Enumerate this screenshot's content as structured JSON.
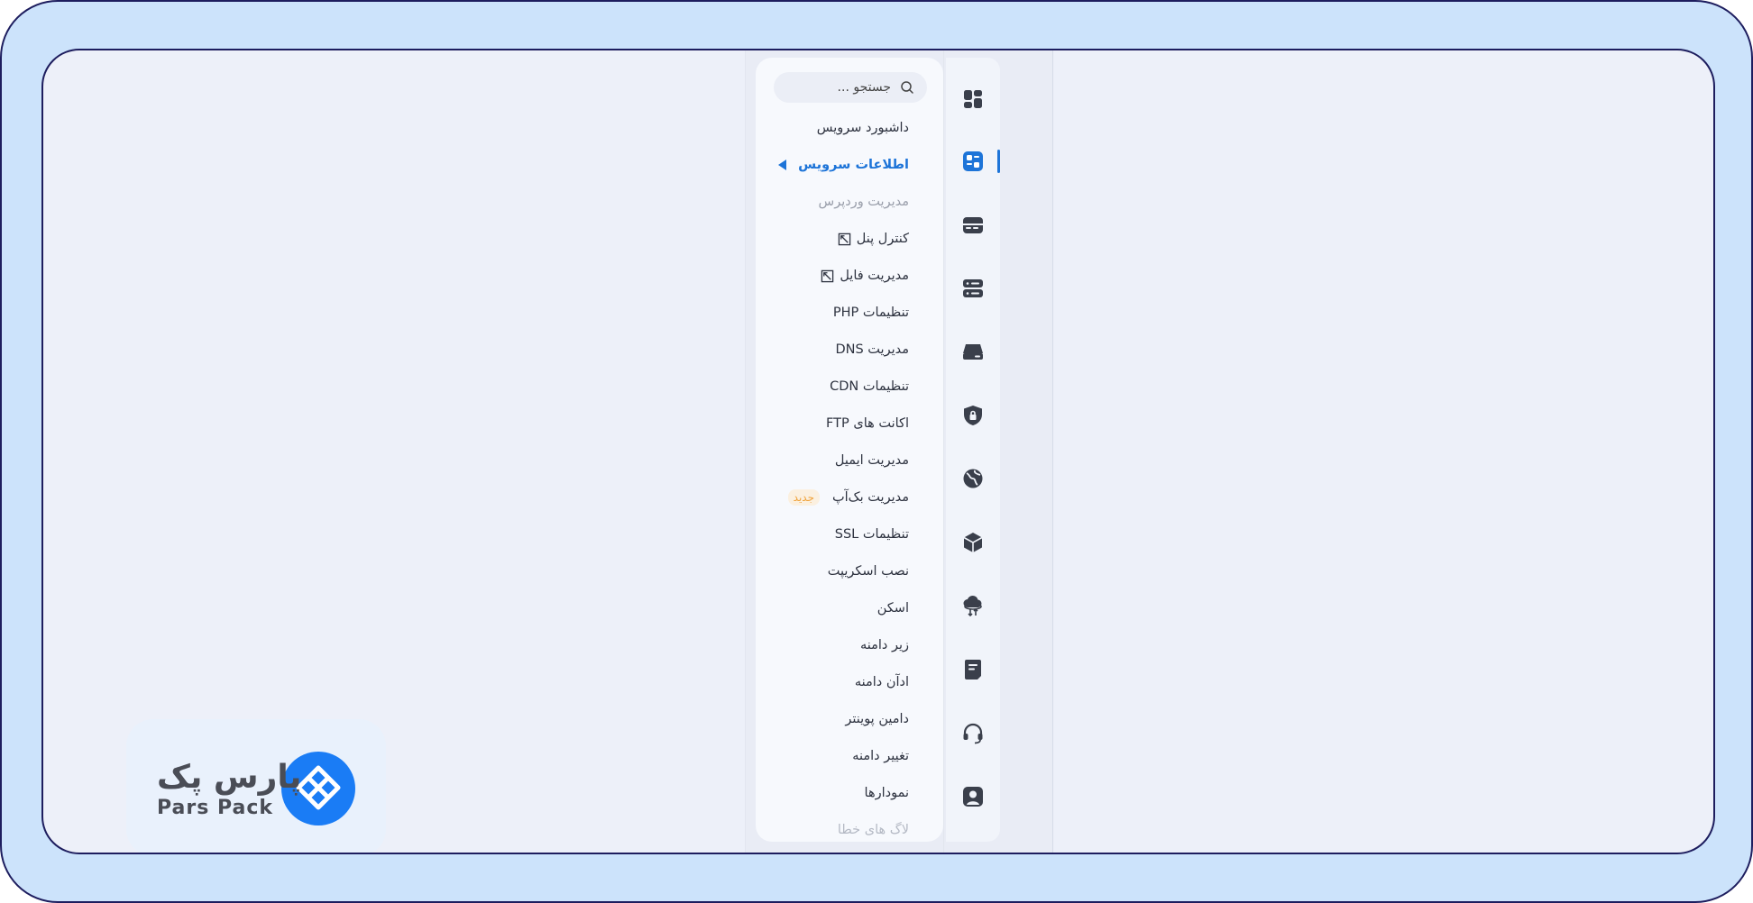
{
  "search": {
    "placeholder": "جستجو ..."
  },
  "menu": {
    "items": [
      {
        "label": "داشبورد سرویس"
      },
      {
        "label": "اطلاعات سرویس"
      },
      {
        "label": "مدیریت وردپرس"
      },
      {
        "label": "کنترل پنل"
      },
      {
        "label": "مدیریت فایل"
      },
      {
        "label": "تنظیمات PHP"
      },
      {
        "label": "مدیریت DNS"
      },
      {
        "label": "تنظیمات CDN"
      },
      {
        "label": "اکانت های FTP"
      },
      {
        "label": "مدیریت ایمیل"
      },
      {
        "label": "مدیریت بک‌آپ",
        "badge": "جدید"
      },
      {
        "label": "تنظیمات SSL"
      },
      {
        "label": "نصب اسکریپت"
      },
      {
        "label": "اسکن"
      },
      {
        "label": "زیر دامنه"
      },
      {
        "label": "ادآن دامنه"
      },
      {
        "label": "دامین پوینتر"
      },
      {
        "label": "تغییر دامنه"
      },
      {
        "label": "نمودارها"
      },
      {
        "label": "لاگ های خطا"
      }
    ]
  },
  "nav_icons": [
    "dashboard-icon",
    "service-info-icon",
    "hosting-icon",
    "server-icon",
    "cloud-drive-icon",
    "security-shield-icon",
    "globe-domain-icon",
    "package-box-icon",
    "cloud-transfer-icon",
    "document-icon",
    "support-headset-icon",
    "user-account-icon"
  ],
  "logo": {
    "name_fa": "پارس پک",
    "name_en": "Pars Pack"
  },
  "colors": {
    "accent": "#1d74d8",
    "badge": "#f0a23a",
    "brand": "#1a7cf5",
    "frame": "#cce3fb",
    "outline": "#1d1d5e"
  }
}
